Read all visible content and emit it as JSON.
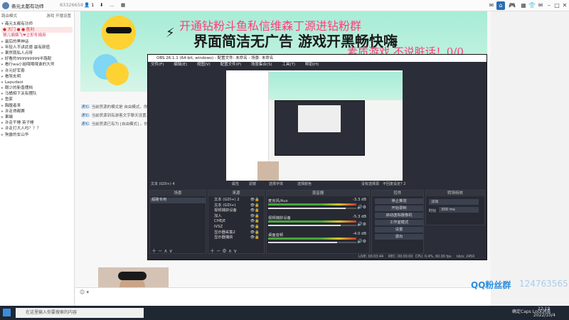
{
  "topbar": {
    "title": "斋元太都有功师",
    "id": "83326658",
    "icons": [
      "home-icon",
      "gamepad-icon",
      "grid-icon",
      "shirt-icon",
      "mail-icon",
      "minimize-icon",
      "maximize-icon",
      "close-icon"
    ]
  },
  "left_panel": {
    "header_left": "路由模式",
    "header_right": "游戏 开播设置",
    "items": [
      {
        "pre": "▾",
        "text": "斋元太都有功师"
      },
      {
        "pre": "",
        "text": "● 大门 ● ● 胜利",
        "highlight": true
      },
      {
        "pre": "",
        "text": "猴儿偏偏飞❤立即冬捐用",
        "highlight": false,
        "pink": true
      },
      {
        "pre": "▸",
        "text": "最后的黑神话"
      },
      {
        "pre": "▸",
        "text": "年轻人不讲武德 最有颜值"
      },
      {
        "pre": "▸",
        "text": "果然我私人点呀"
      },
      {
        "pre": "▸",
        "text": "好看的999999999半路配"
      },
      {
        "pre": "▸",
        "text": "看行wa小姐哦哦哦谁的大师"
      },
      {
        "pre": "▸",
        "text": "许元好军套"
      },
      {
        "pre": "▸",
        "text": "看驾玄明"
      },
      {
        "pre": "▸",
        "text": "Lapudaoi"
      },
      {
        "pre": "▸",
        "text": "眼少的新香摆档"
      },
      {
        "pre": "▸",
        "text": "马桶相下关有摆队"
      },
      {
        "pre": "▸",
        "text": "鱼家"
      },
      {
        "pre": "▸",
        "text": "胸膛者来"
      },
      {
        "pre": "▸",
        "text": "许走得都赛"
      },
      {
        "pre": "▸",
        "text": "果编"
      },
      {
        "pre": "▸",
        "text": "许走干睡 英子睡"
      },
      {
        "pre": "▸",
        "text": "许走打大人吗？？？"
      },
      {
        "pre": "▸",
        "text": "狗露的女山华"
      }
    ]
  },
  "banner": {
    "line1": "开通钻粉斗鱼私信维森丁源进钻粉群",
    "line2": "界面简洁无广告  游戏开黑畅快嗨",
    "line3": "素质游戏 不说脏话！0/0"
  },
  "chat": {
    "lines": [
      {
        "tag": "通知:",
        "text": "当前房源的模式是 自由模式。你"
      },
      {
        "tag": "通知:",
        "text": "当前房源到有游客文字聊天设置..."
      },
      {
        "tag": "通知:",
        "text": "当前房源已有为 [自由模式] 。你"
      },
      {
        "tag": "通知:",
        "text": "该房源已向我为【新通开发】。自"
      }
    ]
  },
  "obs": {
    "title": "OBS 26.1.1 (64-bit, windows) - 配置文件: 未命名 - 场景: 未命名",
    "menu": [
      "文件(F)",
      "编辑(E)",
      "视图(V)",
      "配置文件(P)",
      "场景集合(S)",
      "工具(T)",
      "帮助(H)"
    ],
    "source_label": "文本 (GDI+) 4",
    "toolbar": {
      "props": "属性",
      "filters": "滤镜",
      "select_font": "选择字体",
      "select_color": "选择颜色",
      "no_source": "没有选择源",
      "no_updates": "不回复设定? 2"
    },
    "panels": {
      "scenes": {
        "title": "场景",
        "items": [
          "超路专用"
        ]
      },
      "sources": {
        "title": "来源",
        "items": [
          "文本 (GDI+) 2",
          "文本 (GDI+)",
          "视频捕获设备",
          "加入",
          "CHEJE",
          "IVSZ",
          "显示器采集2",
          "显示器捕获"
        ]
      },
      "mixer": {
        "title": "混音器",
        "tracks": [
          {
            "name": "麦克风/Aux",
            "db": "-3.3 dB",
            "level": 0.88
          },
          {
            "name": "视频捕获设备",
            "db": "-5.3 dB",
            "level": 0.82
          },
          {
            "name": "桌面音频",
            "db": "-4.0 dB",
            "level": 0.78
          }
        ]
      },
      "transitions": {
        "title": "转场特效",
        "type": "淡出",
        "duration_label": "时长",
        "duration": "300 ms"
      },
      "controls": {
        "title": "控件",
        "buttons": [
          "停止推流",
          "开始录制",
          "启动虚拟摄像机",
          "工作室模式",
          "设置",
          "退出"
        ]
      }
    },
    "status": {
      "live": "LIVE: 00:03:44",
      "rec": "REC: 00:00:00",
      "cpu": "CPU: 0.4%, 60.00 fps",
      "kbps": "kb/s: 2450"
    }
  },
  "input": {
    "placeholder": ""
  },
  "qq": {
    "label": "QQ粉丝群",
    "number": "124763565"
  },
  "taskbar": {
    "search_placeholder": "在这里输入你要搜索的内容",
    "time": "22:19",
    "date": "2022/10/4",
    "caps": "确定Caps Lock消息"
  },
  "colors": {
    "accent": "#2a6fb2",
    "banner_pink": "#ff3d7a",
    "obs_bg": "#2b2e38"
  }
}
